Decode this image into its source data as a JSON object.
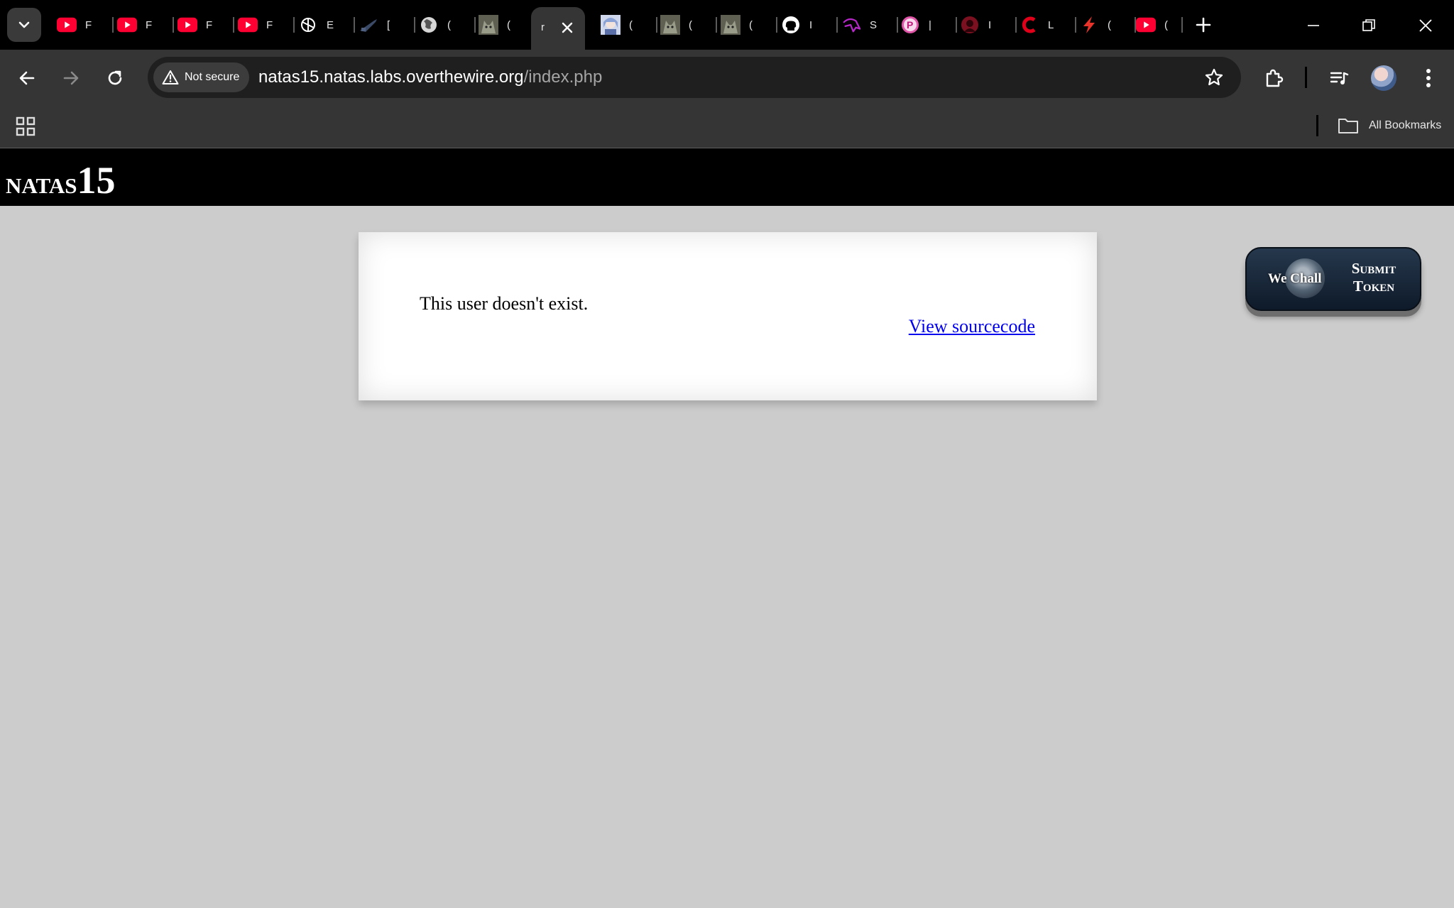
{
  "tabs": [
    {
      "icon": "youtube-icon",
      "title": "F"
    },
    {
      "icon": "youtube-icon",
      "title": "F"
    },
    {
      "icon": "youtube-icon",
      "title": "F"
    },
    {
      "icon": "youtube-icon",
      "title": "F"
    },
    {
      "icon": "openai-icon",
      "title": "E"
    },
    {
      "icon": "sword-icon",
      "title": "["
    },
    {
      "icon": "globe-icon",
      "title": "("
    },
    {
      "icon": "cat-icon",
      "title": "("
    },
    {
      "icon": "anime-avatar-icon",
      "title": "("
    },
    {
      "icon": "cat-icon",
      "title": "("
    },
    {
      "icon": "cat-icon",
      "title": "("
    },
    {
      "icon": "github-icon",
      "title": "I"
    },
    {
      "icon": "unicorn-icon",
      "title": "S"
    },
    {
      "icon": "picsart-icon",
      "title": "|"
    },
    {
      "icon": "dark-avatar-icon",
      "title": "I"
    },
    {
      "icon": "c-logo-icon",
      "title": "L"
    },
    {
      "icon": "bolt-icon",
      "title": "("
    },
    {
      "icon": "youtube-icon",
      "title": "("
    }
  ],
  "active_tab": {
    "title": "r"
  },
  "toolbar": {
    "security_label": "Not secure",
    "url_host": "natas15.natas.labs.overthewire.org",
    "url_path": "/index.php"
  },
  "bookmarks": {
    "all_label": "All Bookmarks"
  },
  "page": {
    "title_word": "natas",
    "title_number": "15",
    "message": "This user doesn't exist.",
    "source_link": "View sourcecode",
    "wechall_name": "We Chall",
    "wechall_line1": "Submit",
    "wechall_line2": "Token"
  },
  "colors": {
    "page_bg": "#cccccc",
    "header_bg": "#000000",
    "link": "#0000ee",
    "youtube_red": "#ff0033"
  }
}
